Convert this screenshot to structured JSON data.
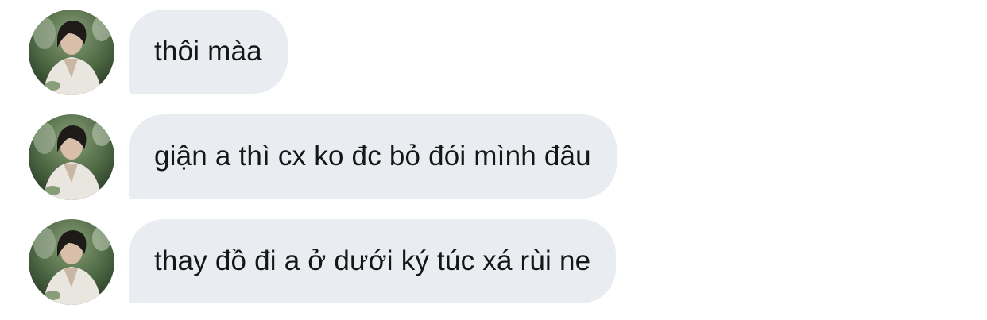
{
  "messages": [
    {
      "sender": "contact",
      "avatar_icon": "profile-photo-icon",
      "text": "thôi màa"
    },
    {
      "sender": "contact",
      "avatar_icon": "profile-photo-icon",
      "text": "giận a thì cx ko đc bỏ đói mình đâu"
    },
    {
      "sender": "contact",
      "avatar_icon": "profile-photo-icon",
      "text": "thay đồ đi a ở dưới ký túc xá rùi ne"
    }
  ],
  "colors": {
    "bubble_background": "#e9ecf0",
    "bubble_text": "#161616",
    "page_background": "#ffffff"
  }
}
